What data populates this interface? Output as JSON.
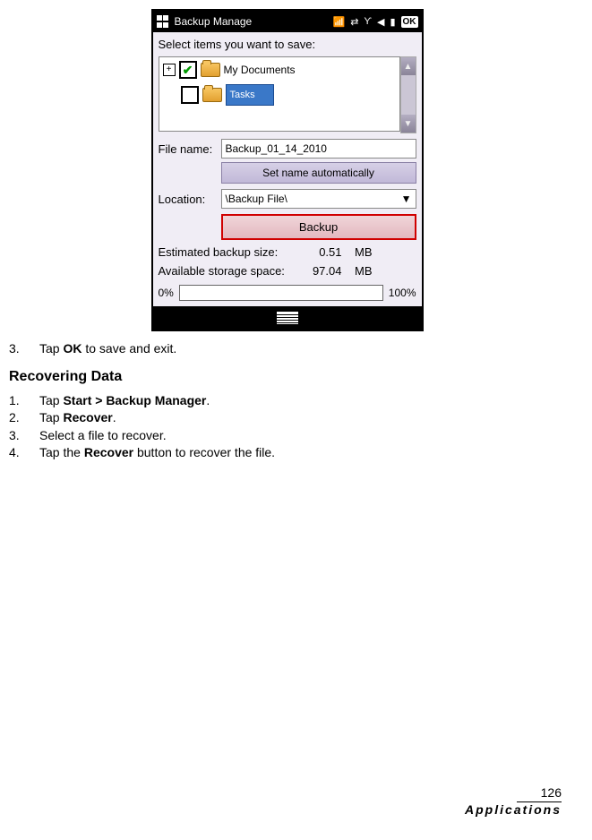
{
  "screenshot": {
    "title": "Backup Manage",
    "ok": "OK",
    "prompt": "Select items you want to save:",
    "tree": {
      "item1": "My Documents",
      "item2": "Tasks"
    },
    "filename_label": "File name:",
    "filename_value": "Backup_01_14_2010",
    "autoname_btn": "Set name automatically",
    "location_label": "Location:",
    "location_value": "\\Backup File\\",
    "backup_btn": "Backup",
    "est_label": "Estimated backup size:",
    "est_value": "0.51",
    "est_unit": "MB",
    "avail_label": "Available storage space:",
    "avail_value": "97.04",
    "avail_unit": "MB",
    "progress_left": "0%",
    "progress_right": "100%"
  },
  "instructions1": {
    "step3": {
      "num": "3.",
      "text_before": "Tap ",
      "bold": "OK",
      "text_after": " to save and exit."
    }
  },
  "heading": "Recovering Data",
  "instructions2": {
    "s1": {
      "num": "1.",
      "a": "Tap ",
      "b": "Start > Backup Manager",
      "c": "."
    },
    "s2": {
      "num": "2.",
      "a": "Tap ",
      "b": "Recover",
      "c": "."
    },
    "s3": {
      "num": "3.",
      "a": "Select a file to recover."
    },
    "s4": {
      "num": "4.",
      "a": "Tap the ",
      "b": "Recover",
      "c": " button to recover the file."
    }
  },
  "footer": {
    "page": "126",
    "section": "Applications"
  }
}
